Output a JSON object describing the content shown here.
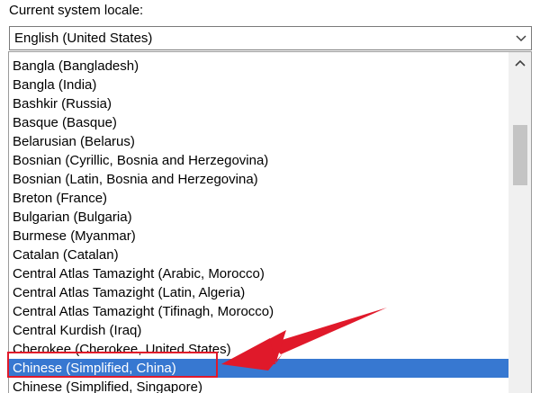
{
  "title": "Current system locale:",
  "combo": {
    "value": "English (United States)",
    "arrow_icon": "chevron-down-icon"
  },
  "list": {
    "items": [
      "Bangla (Bangladesh)",
      "Bangla (India)",
      "Bashkir (Russia)",
      "Basque (Basque)",
      "Belarusian (Belarus)",
      "Bosnian (Cyrillic, Bosnia and Herzegovina)",
      "Bosnian (Latin, Bosnia and Herzegovina)",
      "Breton (France)",
      "Bulgarian (Bulgaria)",
      "Burmese (Myanmar)",
      "Catalan (Catalan)",
      "Central Atlas Tamazight (Arabic, Morocco)",
      "Central Atlas Tamazight (Latin, Algeria)",
      "Central Atlas Tamazight (Tifinagh, Morocco)",
      "Central Kurdish (Iraq)",
      "Cherokee (Cherokee, United States)",
      "Chinese (Simplified, China)",
      "Chinese (Simplified, Singapore)"
    ],
    "selected_index": 16
  },
  "colors": {
    "selection": "#3778d1",
    "annotation": "#e0192a"
  },
  "icons": {
    "scroll_up": "chevron-up-icon",
    "annotation_arrow": "red-arrow-annotation"
  }
}
